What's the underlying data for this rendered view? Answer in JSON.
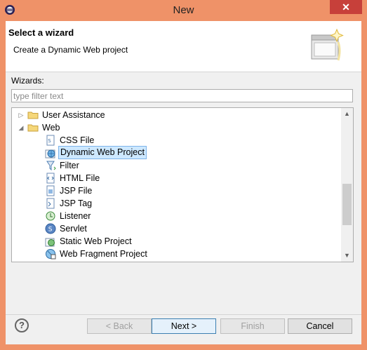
{
  "window": {
    "title": "New",
    "close_glyph": "✕"
  },
  "banner": {
    "title": "Select a wizard",
    "description": "Create a Dynamic Web project",
    "image_icon": "wizard-banner-icon"
  },
  "filter": {
    "label": "Wizards:",
    "placeholder": "type filter text",
    "value": ""
  },
  "tree": {
    "items": [
      {
        "label": "User Assistance",
        "level": 0,
        "expanded": false,
        "icon": "folder-icon"
      },
      {
        "label": "Web",
        "level": 0,
        "expanded": true,
        "icon": "folder-icon"
      },
      {
        "label": "CSS File",
        "level": 1,
        "icon": "css-file-icon"
      },
      {
        "label": "Dynamic Web Project",
        "level": 1,
        "icon": "dynamic-web-project-icon",
        "selected": true
      },
      {
        "label": "Filter",
        "level": 1,
        "icon": "filter-icon"
      },
      {
        "label": "HTML File",
        "level": 1,
        "icon": "html-file-icon"
      },
      {
        "label": "JSP File",
        "level": 1,
        "icon": "jsp-file-icon"
      },
      {
        "label": "JSP Tag",
        "level": 1,
        "icon": "jsp-tag-icon"
      },
      {
        "label": "Listener",
        "level": 1,
        "icon": "listener-icon"
      },
      {
        "label": "Servlet",
        "level": 1,
        "icon": "servlet-icon"
      },
      {
        "label": "Static Web Project",
        "level": 1,
        "icon": "static-web-project-icon"
      },
      {
        "label": "Web Fragment Project",
        "level": 1,
        "icon": "web-fragment-project-icon"
      }
    ],
    "scroll": {
      "position": 0.72,
      "visible_fraction": 0.32
    }
  },
  "buttons": {
    "help_glyph": "?",
    "back": "< Back",
    "next": "Next >",
    "finish": "Finish",
    "cancel": "Cancel"
  },
  "colors": {
    "titlebar": "#ef9268",
    "selection": "#cde8ff",
    "close": "#c7403a"
  }
}
